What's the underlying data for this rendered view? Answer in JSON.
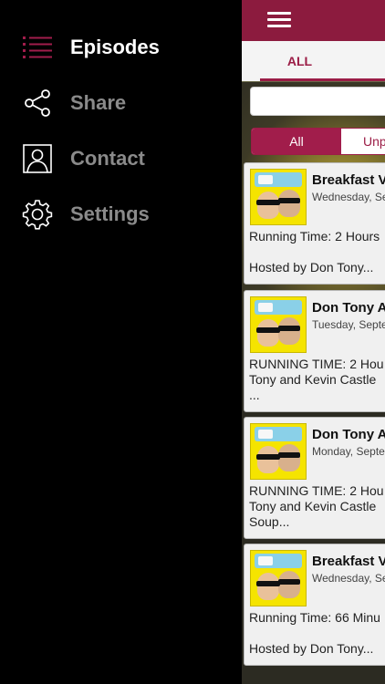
{
  "menu": {
    "items": [
      {
        "label": "Episodes",
        "icon": "list-icon",
        "active": true
      },
      {
        "label": "Share",
        "icon": "share-icon",
        "active": false
      },
      {
        "label": "Contact",
        "icon": "contact-icon",
        "active": false
      },
      {
        "label": "Settings",
        "icon": "gear-icon",
        "active": false
      }
    ]
  },
  "content": {
    "tab_all": "ALL",
    "search_placeholder": "",
    "segment": {
      "all": "All",
      "unplayed": "Unpl"
    },
    "episodes": [
      {
        "title": "Breakfast V",
        "date": "Wednesday, Se",
        "desc_lines": [
          "Running Time: 2 Hours",
          "",
          "Hosted by Don Tony..."
        ]
      },
      {
        "title": "Don Tony A",
        "date": "Tuesday, Septe",
        "desc_lines": [
          "RUNNING TIME: 2 Hou",
          "Tony and Kevin Castle",
          "..."
        ]
      },
      {
        "title": "Don Tony A",
        "date": "Monday, Septe",
        "desc_lines": [
          "RUNNING TIME: 2 Hou",
          "Tony and Kevin Castle",
          "Soup..."
        ]
      },
      {
        "title": "Breakfast V",
        "date": "Wednesday, Se",
        "desc_lines": [
          "Running Time: 66 Minu",
          "",
          "Hosted by Don Tony..."
        ]
      }
    ]
  },
  "colors": {
    "accent": "#8c1b3e",
    "segment": "#a11d4b",
    "inactive_menu": "#8a8a8a"
  }
}
